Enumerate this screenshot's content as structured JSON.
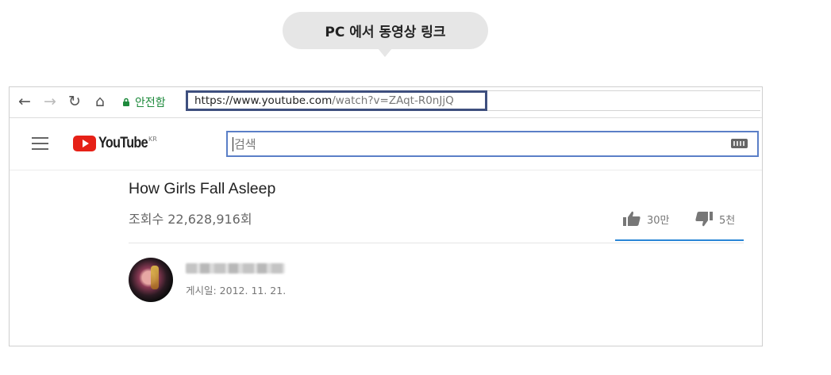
{
  "callout": {
    "text": "PC 에서 동영상 링크"
  },
  "browser": {
    "nav": {
      "back": "←",
      "forward": "→",
      "reload": "↻",
      "home": "⌂"
    },
    "security_label": "안전함",
    "url_main": "https://www.youtube.com",
    "url_rest": "/watch?v=ZAqt-R0nJjQ"
  },
  "youtube": {
    "logo_text": "YouTube",
    "country_code": "KR",
    "search_placeholder": "검색"
  },
  "video": {
    "title": "How Girls Fall Asleep",
    "views": "조회수 22,628,916회",
    "likes": "30만",
    "dislikes": "5천",
    "publish_date": "게시일: 2012. 11. 21."
  },
  "icons": {
    "lock": "lock-icon",
    "menu": "menu-icon",
    "keyboard": "keyboard-icon",
    "thumbs_up": "thumbs-up-icon",
    "thumbs_down": "thumbs-down-icon"
  },
  "colors": {
    "url_highlight": "#3e4f7e",
    "secure_green": "#1e8a3c",
    "youtube_red": "#e62117",
    "search_focus": "#5b7fc7",
    "like_underline": "#2a86d6"
  }
}
